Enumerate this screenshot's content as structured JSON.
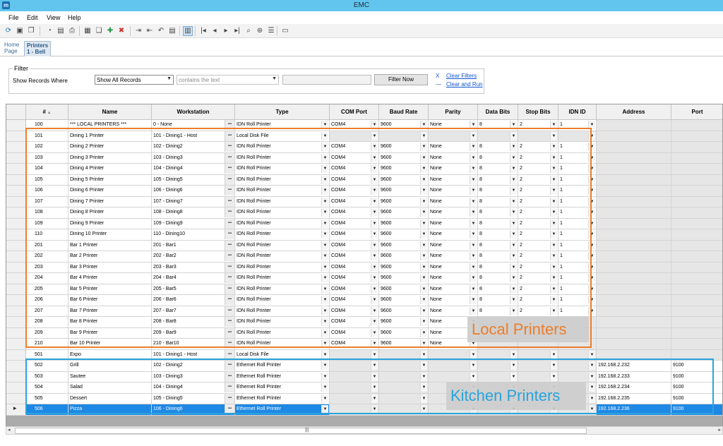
{
  "window": {
    "title": "EMC",
    "app_icon": "m"
  },
  "menu": [
    "File",
    "Edit",
    "View",
    "Help"
  ],
  "toolbar_icons": [
    "refresh-icon",
    "folder-open-icon",
    "copy-file-icon",
    "history-icon",
    "page-icon",
    "print-icon",
    "save-icon",
    "save-copy-icon",
    "add-icon",
    "delete-icon",
    "import-icon",
    "export-icon",
    "undo-icon",
    "paste-icon",
    "grid-view-icon",
    "first-icon",
    "prev-icon",
    "next-icon",
    "last-icon",
    "search-text-icon",
    "binoculars-icon",
    "list-icon",
    "window-icon"
  ],
  "tabs": [
    {
      "label": "Home Page",
      "active": false
    },
    {
      "label": "Printers 1 - Bell",
      "active": true
    }
  ],
  "filter": {
    "legend": "Filter",
    "label": "Show Records Where",
    "field_value": "Show All Records",
    "operator_value": "contains the text",
    "button": "Filter Now",
    "clear_icon": "X",
    "clear_link": "Clear Filters",
    "run_link": "Clear and Run"
  },
  "columns": [
    "#",
    "Name",
    "Workstation",
    "Type",
    "COM Port",
    "Baud Rate",
    "Parity",
    "Data Bits",
    "Stop Bits",
    "IDN ID",
    "Address",
    "Port"
  ],
  "rows": [
    [
      "100",
      "*** LOCAL PRINTERS ***",
      "0 - None",
      "IDN Roll Printer",
      "COM4",
      "9600",
      "None",
      "8",
      "2",
      "1",
      "",
      ""
    ],
    [
      "101",
      "Dining 1 Printer",
      "101 - Dining1 - Host",
      "Local Disk File",
      "",
      "",
      "",
      "",
      "",
      "",
      "",
      ""
    ],
    [
      "102",
      "Dining 2 Printer",
      "102 - Dining2",
      "IDN Roll Printer",
      "COM4",
      "9600",
      "None",
      "8",
      "2",
      "1",
      "",
      ""
    ],
    [
      "103",
      "Dining 3 Printer",
      "103 - Dining3",
      "IDN Roll Printer",
      "COM4",
      "9600",
      "None",
      "8",
      "2",
      "1",
      "",
      ""
    ],
    [
      "104",
      "Dining 4 Printer",
      "104 - Dining4",
      "IDN Roll Printer",
      "COM4",
      "9600",
      "None",
      "8",
      "2",
      "1",
      "",
      ""
    ],
    [
      "105",
      "Dining 5 Printer",
      "105 - Dining5",
      "IDN Roll Printer",
      "COM4",
      "9600",
      "None",
      "8",
      "2",
      "1",
      "",
      ""
    ],
    [
      "106",
      "Dining 6 Printer",
      "106 - Dining6",
      "IDN Roll Printer",
      "COM4",
      "9600",
      "None",
      "8",
      "2",
      "1",
      "",
      ""
    ],
    [
      "107",
      "Dining 7 Printer",
      "107 - Dining7",
      "IDN Roll Printer",
      "COM4",
      "9600",
      "None",
      "8",
      "2",
      "1",
      "",
      ""
    ],
    [
      "108",
      "Dining 8 Printer",
      "108 - Dining8",
      "IDN Roll Printer",
      "COM4",
      "9600",
      "None",
      "8",
      "2",
      "1",
      "",
      ""
    ],
    [
      "109",
      "Dining 9 Printer",
      "109 - Dining9",
      "IDN Roll Printer",
      "COM4",
      "9600",
      "None",
      "8",
      "2",
      "1",
      "",
      ""
    ],
    [
      "110",
      "Dining 10 Printer",
      "110 - Dining10",
      "IDN Roll Printer",
      "COM4",
      "9600",
      "None",
      "8",
      "2",
      "1",
      "",
      ""
    ],
    [
      "201",
      "Bar 1 Printer",
      "201 - Bar1",
      "IDN Roll Printer",
      "COM4",
      "9600",
      "None",
      "8",
      "2",
      "1",
      "",
      ""
    ],
    [
      "202",
      "Bar 2 Printer",
      "202 - Bar2",
      "IDN Roll Printer",
      "COM4",
      "9600",
      "None",
      "8",
      "2",
      "1",
      "",
      ""
    ],
    [
      "203",
      "Bar 3 Printer",
      "203 - Bar3",
      "IDN Roll Printer",
      "COM4",
      "9600",
      "None",
      "8",
      "2",
      "1",
      "",
      ""
    ],
    [
      "204",
      "Bar 4 Printer",
      "204 - Bar4",
      "IDN Roll Printer",
      "COM4",
      "9600",
      "None",
      "8",
      "2",
      "1",
      "",
      ""
    ],
    [
      "205",
      "Bar 5 Printer",
      "205 - Bar5",
      "IDN Roll Printer",
      "COM4",
      "9600",
      "None",
      "8",
      "2",
      "1",
      "",
      ""
    ],
    [
      "206",
      "Bar 6 Printer",
      "206 - Bar6",
      "IDN Roll Printer",
      "COM4",
      "9600",
      "None",
      "8",
      "2",
      "1",
      "",
      ""
    ],
    [
      "207",
      "Bar 7 Printer",
      "207 - Bar7",
      "IDN Roll Printer",
      "COM4",
      "9600",
      "None",
      "8",
      "2",
      "1",
      "",
      ""
    ],
    [
      "208",
      "Bar 8 Printer",
      "208 - Bar8",
      "IDN Roll Printer",
      "COM4",
      "9600",
      "None",
      "",
      "",
      "",
      "",
      ""
    ],
    [
      "209",
      "Bar 9 Printer",
      "209 - Bar9",
      "IDN Roll Printer",
      "COM4",
      "9600",
      "None",
      "",
      "",
      "",
      "",
      ""
    ],
    [
      "210",
      "Bar 10 Printer",
      "210 - Bar10",
      "IDN Roll Printer",
      "COM4",
      "9600",
      "None",
      "",
      "",
      "",
      "",
      ""
    ],
    [
      "501",
      "Expo",
      "101 - Dining1 - Host",
      "Local Disk File",
      "",
      "",
      "",
      "",
      "",
      "",
      "",
      ""
    ],
    [
      "502",
      "Grill",
      "102 - Dining2",
      "Ethernet Roll Printer",
      "",
      "",
      "",
      "",
      "",
      "",
      "192.168.2.232",
      "9100"
    ],
    [
      "503",
      "Sautee",
      "103 - Dining3",
      "Ethernet Roll Printer",
      "",
      "",
      "",
      "",
      "",
      "",
      "192.168.2.233",
      "9100"
    ],
    [
      "504",
      "Salad",
      "104 - Dining4",
      "Ethernet Roll Printer",
      "",
      "",
      "",
      "",
      "",
      "",
      "192.168.2.234",
      "9100"
    ],
    [
      "505",
      "Dessert",
      "105 - Dining5",
      "Ethernet Roll Printer",
      "",
      "",
      "",
      "",
      "",
      "",
      "192.168.2.235",
      "9100"
    ],
    [
      "506",
      "Pizza",
      "106 - Dining6",
      "Ethernet Roll Printer",
      "",
      "",
      "",
      "",
      "",
      "",
      "192.168.2.236",
      "9100"
    ]
  ],
  "selected_row": 26,
  "annotations": {
    "local": "Local Printers",
    "kitchen": "Kitchen Printers"
  },
  "colors": {
    "titlebar": "#62c5ee",
    "selection": "#1e88e5",
    "local_box": "#ee7d2a",
    "kitchen_box": "#29a3dc"
  }
}
